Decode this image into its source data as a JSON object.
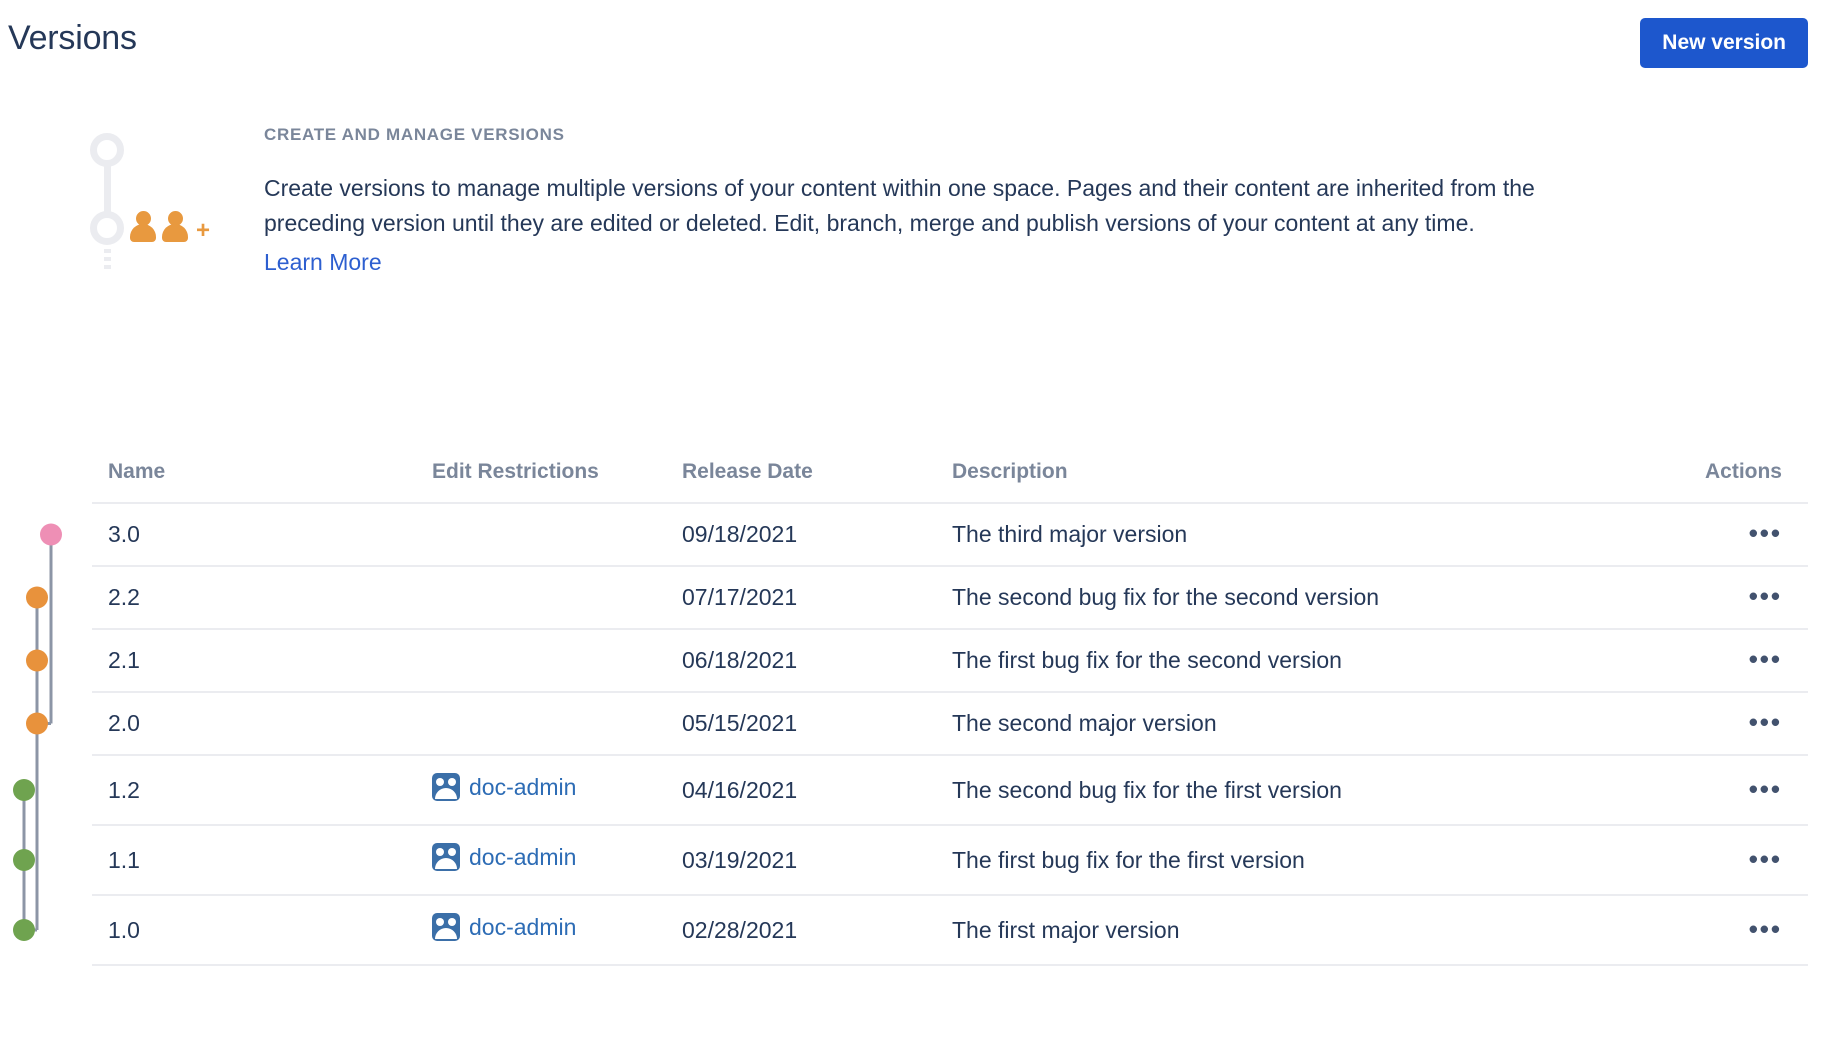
{
  "header": {
    "title": "Versions",
    "new_version_label": "New version"
  },
  "intro": {
    "eyebrow": "CREATE AND MANAGE VERSIONS",
    "body": "Create versions to manage multiple versions of your content within one space. Pages and their content are inherited from the preceding version until they are edited or deleted. Edit, branch, merge and publish versions of your content at any time.",
    "learn_more_label": "Learn More",
    "illustration_icon": "versions-people-add-icon"
  },
  "table": {
    "columns": {
      "name": "Name",
      "edit_restrictions": "Edit Restrictions",
      "release_date": "Release Date",
      "description": "Description",
      "actions": "Actions"
    },
    "actions_glyph": "•••",
    "rows": [
      {
        "name": "3.0",
        "restriction": "",
        "release_date": "09/18/2021",
        "description": "The third major version",
        "dot_color": "#ee8fb5",
        "branch": "pink"
      },
      {
        "name": "2.2",
        "restriction": "",
        "release_date": "07/17/2021",
        "description": "The second bug fix for the second version",
        "dot_color": "#e8923c",
        "branch": "orange"
      },
      {
        "name": "2.1",
        "restriction": "",
        "release_date": "06/18/2021",
        "description": "The first bug fix for the second version",
        "dot_color": "#e8923c",
        "branch": "orange"
      },
      {
        "name": "2.0",
        "restriction": "",
        "release_date": "05/15/2021",
        "description": "The second major version",
        "dot_color": "#e8923c",
        "branch": "orange"
      },
      {
        "name": "1.2",
        "restriction": "doc-admin",
        "release_date": "04/16/2021",
        "description": "The second bug fix for the first version",
        "dot_color": "#6fa34f",
        "branch": "green"
      },
      {
        "name": "1.1",
        "restriction": "doc-admin",
        "release_date": "03/19/2021",
        "description": "The first bug fix for the first version",
        "dot_color": "#6fa34f",
        "branch": "green"
      },
      {
        "name": "1.0",
        "restriction": "doc-admin",
        "release_date": "02/28/2021",
        "description": "The first major version",
        "dot_color": "#6fa34f",
        "branch": "green"
      }
    ]
  },
  "colors": {
    "accent_blue": "#1d57cd",
    "link_blue": "#2d5fd0",
    "text": "#253858",
    "muted": "#7a869a",
    "graph_line": "#8c95a6",
    "pink": "#ee8fb5",
    "orange": "#e8923c",
    "green": "#6fa34f"
  }
}
